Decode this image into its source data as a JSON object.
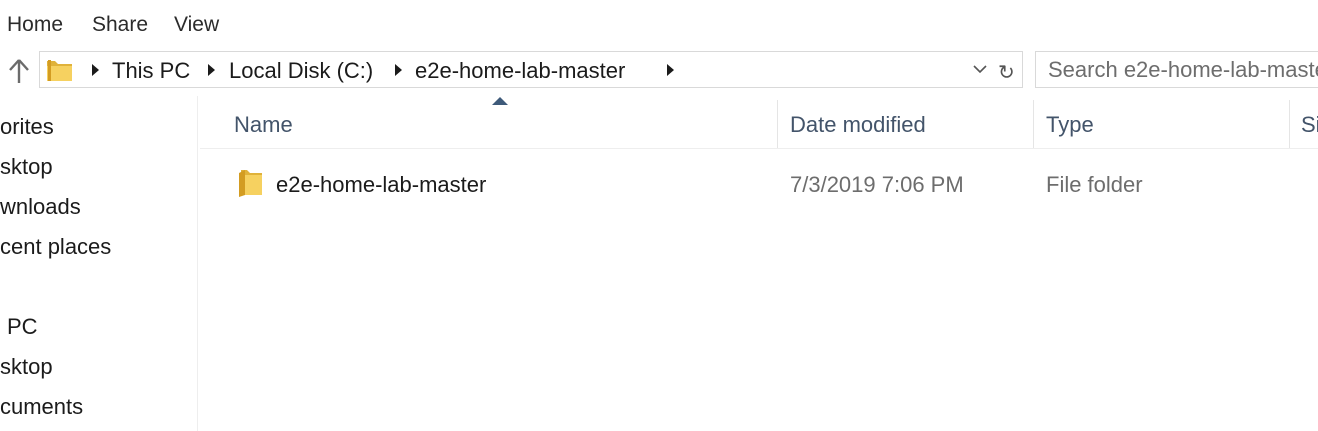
{
  "ribbon": {
    "tabs": [
      "Home",
      "Share",
      "View"
    ]
  },
  "address_bar": {
    "breadcrumbs": [
      "This PC",
      "Local Disk (C:)",
      "e2e-home-lab-master"
    ]
  },
  "search": {
    "placeholder": "Search e2e-home-lab-master"
  },
  "nav_pane": {
    "items": [
      "orites",
      "sktop",
      "wnloads",
      "cent places",
      "PC",
      "sktop",
      "cuments"
    ]
  },
  "columns": [
    "Name",
    "Date modified",
    "Type",
    "Si"
  ],
  "files": [
    {
      "name": "e2e-home-lab-master",
      "date_modified": "7/3/2019 7:06 PM",
      "type": "File folder",
      "icon": "folder-icon"
    }
  ],
  "colors": {
    "header_text": "#43546a",
    "folder_yellow": "#f3c94c",
    "secondary_text": "#6d6d6d"
  }
}
